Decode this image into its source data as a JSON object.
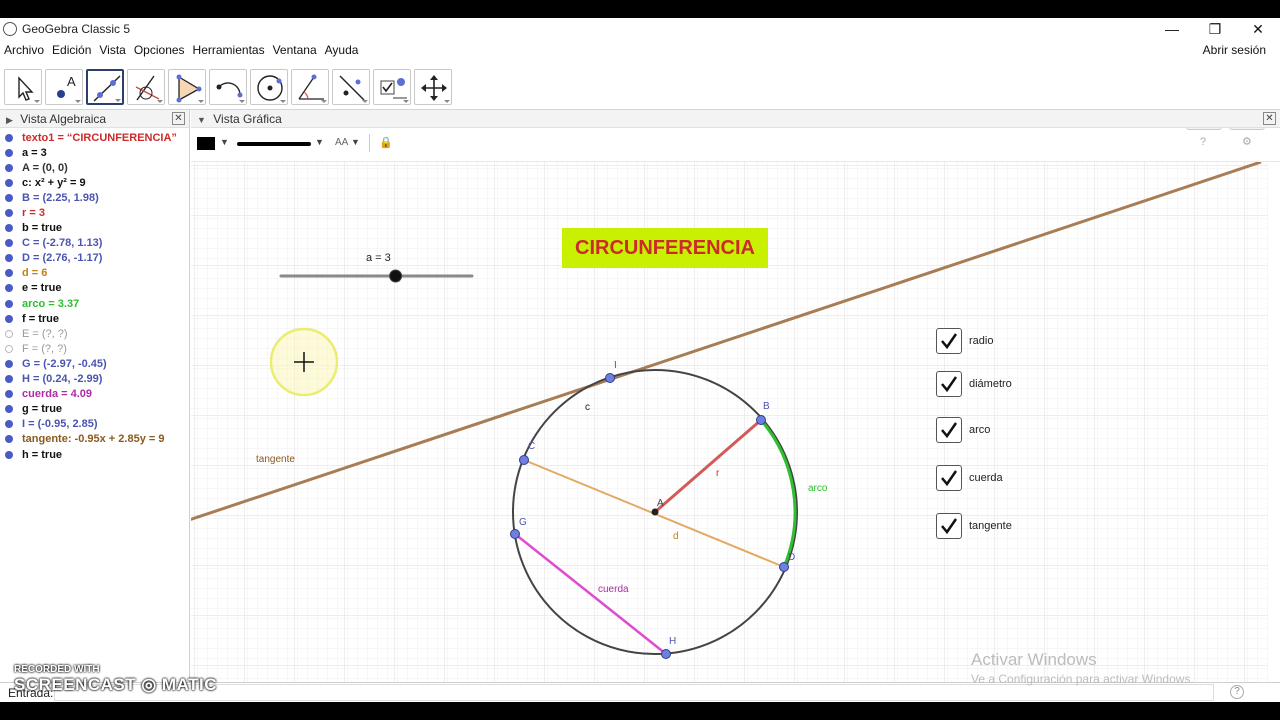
{
  "window": {
    "title": "GeoGebra Classic 5",
    "controls": [
      "—",
      "❐",
      "✕"
    ]
  },
  "menu": [
    "Archivo",
    "Edición",
    "Vista",
    "Opciones",
    "Herramientas",
    "Ventana",
    "Ayuda"
  ],
  "signin": "Abrir sesión",
  "toolbar": {
    "tools": [
      "move-tool",
      "point-tool",
      "line-tool",
      "perpendicular-tool",
      "polygon-tool",
      "circle-arc-tool",
      "circle-tool",
      "angle-tool",
      "reflect-tool",
      "slider-tool",
      "move-view-tool"
    ],
    "undo": "↶",
    "redo": "↷"
  },
  "algebra": {
    "title": "Vista Algebraica",
    "items": [
      {
        "text": "texto1 = “CIRCUNFERENCIA”",
        "color": "#cc2b2b",
        "visible": true
      },
      {
        "text": "a = 3",
        "color": "#111111",
        "visible": true
      },
      {
        "text": "A = (0, 0)",
        "color": "#333333",
        "visible": true
      },
      {
        "text": "c: x² + y² = 9",
        "color": "#111111",
        "visible": true
      },
      {
        "text": "B = (2.25, 1.98)",
        "color": "#4a55b0",
        "visible": true
      },
      {
        "text": "r = 3",
        "color": "#cc2b2b",
        "visible": true
      },
      {
        "text": "b = true",
        "color": "#111111",
        "visible": true
      },
      {
        "text": "C = (-2.78, 1.13)",
        "color": "#4a55b0",
        "visible": true
      },
      {
        "text": "D = (2.76, -1.17)",
        "color": "#4a55b0",
        "visible": true
      },
      {
        "text": "d = 6",
        "color": "#c77e12",
        "visible": true
      },
      {
        "text": "e = true",
        "color": "#111111",
        "visible": true
      },
      {
        "text": "arco = 3.37",
        "color": "#2ec02e",
        "visible": true
      },
      {
        "text": "f = true",
        "color": "#111111",
        "visible": true
      },
      {
        "text": "E = (?, ?)",
        "color": "#999999",
        "visible": false
      },
      {
        "text": "F = (?, ?)",
        "color": "#999999",
        "visible": false
      },
      {
        "text": "G = (-2.97, -0.45)",
        "color": "#4a55b0",
        "visible": true
      },
      {
        "text": "H = (0.24, -2.99)",
        "color": "#4a55b0",
        "visible": true
      },
      {
        "text": "cuerda = 4.09",
        "color": "#b02aa8",
        "visible": true
      },
      {
        "text": "g = true",
        "color": "#111111",
        "visible": true
      },
      {
        "text": "I = (-0.95, 2.85)",
        "color": "#4a55b0",
        "visible": true
      },
      {
        "text": "tangente: -0.95x + 2.85y = 9",
        "color": "#8a5a20",
        "visible": true
      },
      {
        "text": "h = true",
        "color": "#111111",
        "visible": true
      }
    ]
  },
  "graphics": {
    "title": "Vista Gráfica",
    "font_size_label": "AA",
    "text_box": "CIRCUNFERENCIA",
    "slider": {
      "label": "a = 3",
      "value": 3
    },
    "labels": {
      "c": "c",
      "A": "A",
      "B": "B",
      "C": "C",
      "D": "D",
      "G": "G",
      "H": "H",
      "I": "I",
      "r": "r",
      "d": "d",
      "arco": "arco",
      "cuerda": "cuerda",
      "tangente": "tangente"
    },
    "checkboxes": [
      {
        "label": "radio",
        "checked": true
      },
      {
        "label": "diámetro",
        "checked": true
      },
      {
        "label": "arco",
        "checked": true
      },
      {
        "label": "cuerda",
        "checked": true
      },
      {
        "label": "tangente",
        "checked": true
      }
    ]
  },
  "input": {
    "label": "Entrada:",
    "value": "",
    "help": "?"
  },
  "watermark": {
    "line1": "RECORDED WITH",
    "line2": "SCREENCAST ◎ MATIC"
  },
  "activation": {
    "line1": "Activar Windows",
    "line2": "Ve a Configuración para activar Windows."
  }
}
